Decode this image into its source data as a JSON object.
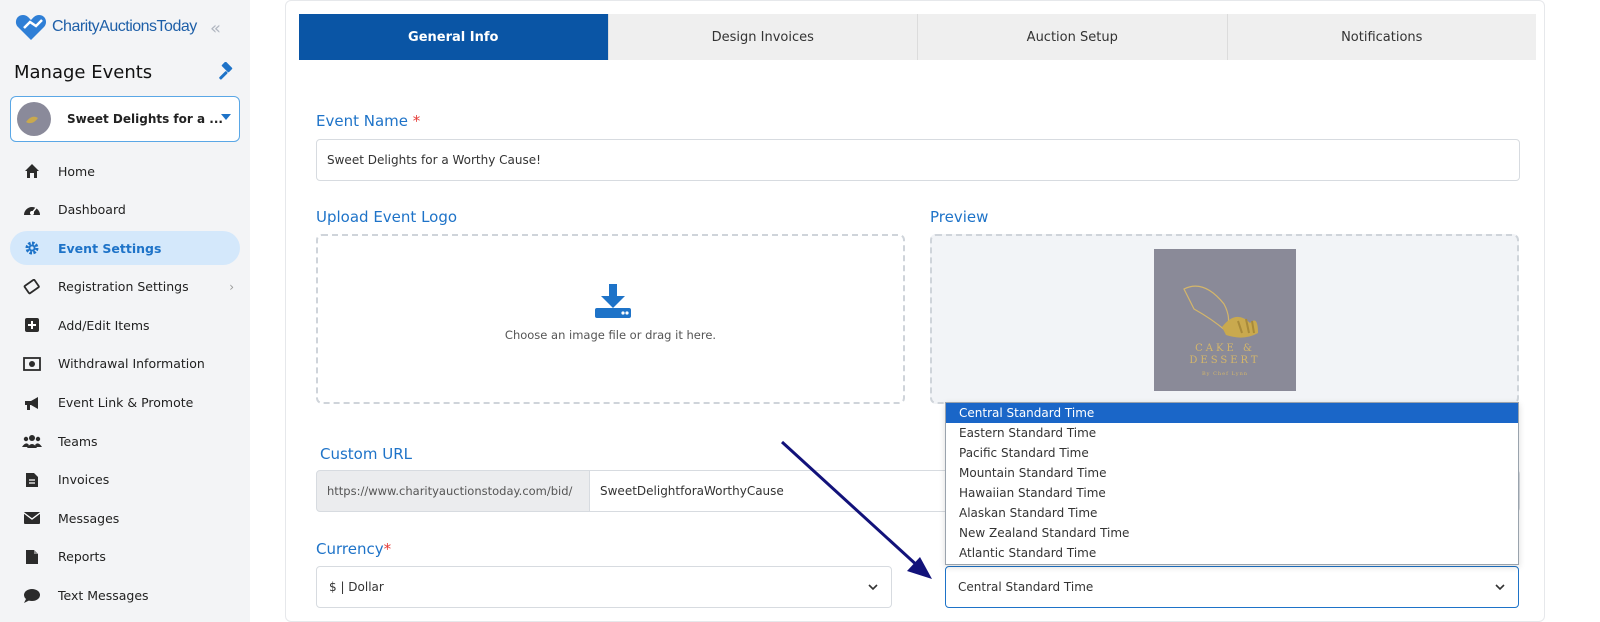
{
  "app": {
    "logo_text": "CharityAuctionsToday",
    "manage_title": "Manage Events"
  },
  "event_selector": {
    "value": "Sweet Delights for a ..."
  },
  "sidebar": {
    "items": [
      {
        "label": "Home",
        "icon": "home-icon"
      },
      {
        "label": "Dashboard",
        "icon": "dashboard-icon"
      },
      {
        "label": "Event Settings",
        "icon": "gear-icon",
        "active": true
      },
      {
        "label": "Registration Settings",
        "icon": "ticket-icon",
        "has_submenu": true
      },
      {
        "label": "Add/Edit Items",
        "icon": "plus-square-icon"
      },
      {
        "label": "Withdrawal Information",
        "icon": "money-icon"
      },
      {
        "label": "Event Link & Promote",
        "icon": "megaphone-icon"
      },
      {
        "label": "Teams",
        "icon": "users-icon"
      },
      {
        "label": "Invoices",
        "icon": "document-icon"
      },
      {
        "label": "Messages",
        "icon": "envelope-icon"
      },
      {
        "label": "Reports",
        "icon": "report-icon"
      },
      {
        "label": "Text Messages",
        "icon": "chat-icon"
      }
    ]
  },
  "tabs": [
    {
      "label": "General Info",
      "active": true
    },
    {
      "label": "Design Invoices"
    },
    {
      "label": "Auction Setup"
    },
    {
      "label": "Notifications"
    }
  ],
  "form": {
    "event_name_label": "Event Name",
    "required_mark": "*",
    "event_name_value": "Sweet Delights for a Worthy Cause!",
    "upload_label": "Upload Event Logo",
    "upload_hint": "Choose an image file or drag it here.",
    "preview_label": "Preview",
    "preview_logo_line1": "CAKE  &",
    "preview_logo_line2": "DESSERT",
    "preview_logo_line3": "By  Chef Lynn",
    "custom_url_label": "Custom URL",
    "custom_url_prefix": "https://www.charityauctionstoday.com/bid/",
    "custom_url_value": "SweetDelightforaWorthyCause",
    "currency_label": "Currency",
    "currency_value": "$ | Dollar",
    "timezone_value": "Central Standard Time"
  },
  "timezone_dropdown": {
    "options": [
      "Central Standard Time",
      "Eastern Standard Time",
      "Pacific Standard Time",
      "Mountain Standard Time",
      "Hawaiian Standard Time",
      "Alaskan Standard Time",
      "New Zealand Standard Time",
      "Atlantic Standard Time"
    ],
    "selected_index": 0
  },
  "colors": {
    "accent": "#1e73c8",
    "tab_active": "#0a55a5",
    "annotation_arrow": "#12127a"
  }
}
